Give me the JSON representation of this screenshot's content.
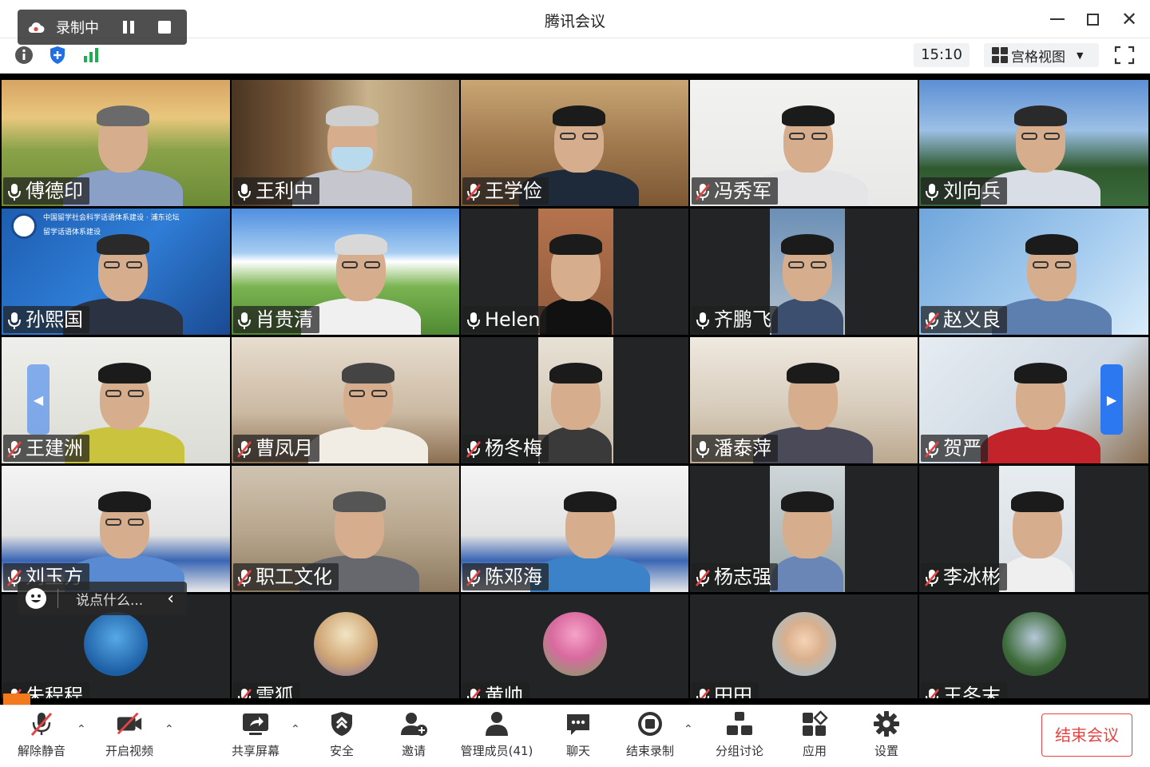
{
  "window": {
    "title": "腾讯会议"
  },
  "infobar": {
    "time": "15:10",
    "view_mode": "宫格视图"
  },
  "recording": {
    "label": "录制中"
  },
  "chat": {
    "placeholder": "说点什么..."
  },
  "participants": [
    {
      "name": "傅德印",
      "mic": "on"
    },
    {
      "name": "王利中",
      "mic": "on"
    },
    {
      "name": "王学俭",
      "mic": "muted"
    },
    {
      "name": "冯秀军",
      "mic": "muted"
    },
    {
      "name": "刘向兵",
      "mic": "on"
    },
    {
      "name": "孙熙国",
      "mic": "on"
    },
    {
      "name": "肖贵清",
      "mic": "on"
    },
    {
      "name": "Helen",
      "mic": "on"
    },
    {
      "name": "齐鹏飞",
      "mic": "on"
    },
    {
      "name": "赵义良",
      "mic": "muted"
    },
    {
      "name": "王建洲",
      "mic": "muted"
    },
    {
      "name": "曹凤月",
      "mic": "muted"
    },
    {
      "name": "杨冬梅",
      "mic": "muted"
    },
    {
      "name": "潘泰萍",
      "mic": "on"
    },
    {
      "name": "贺严",
      "mic": "muted"
    },
    {
      "name": "刘玉方",
      "mic": "muted"
    },
    {
      "name": "职工文化",
      "mic": "muted"
    },
    {
      "name": "陈邓海",
      "mic": "muted"
    },
    {
      "name": "杨志强",
      "mic": "muted"
    },
    {
      "name": "李冰彬",
      "mic": "muted"
    },
    {
      "name": "朱程程",
      "mic": "muted"
    },
    {
      "name": "雪狐",
      "mic": "muted"
    },
    {
      "name": "黄帅",
      "mic": "muted"
    },
    {
      "name": "田田",
      "mic": "muted"
    },
    {
      "name": "王冬末",
      "mic": "muted"
    }
  ],
  "tile_text": {
    "banner_line1": "中国留学社会科学话语体系建设 · 浦东论坛",
    "banner_line2": "留学话语体系建设"
  },
  "toolbar": {
    "unmute": "解除静音",
    "start_video": "开启视频",
    "share_screen": "共享屏幕",
    "security": "安全",
    "invite": "邀请",
    "members": "管理成员(41)",
    "chat": "聊天",
    "end_recording": "结束录制",
    "breakout": "分组讨论",
    "apps": "应用",
    "settings": "设置",
    "end_meeting": "结束会议"
  },
  "colors": {
    "accent_blue": "#2b78f0",
    "end_red": "#e54444",
    "record_orange": "#f27a1d"
  }
}
